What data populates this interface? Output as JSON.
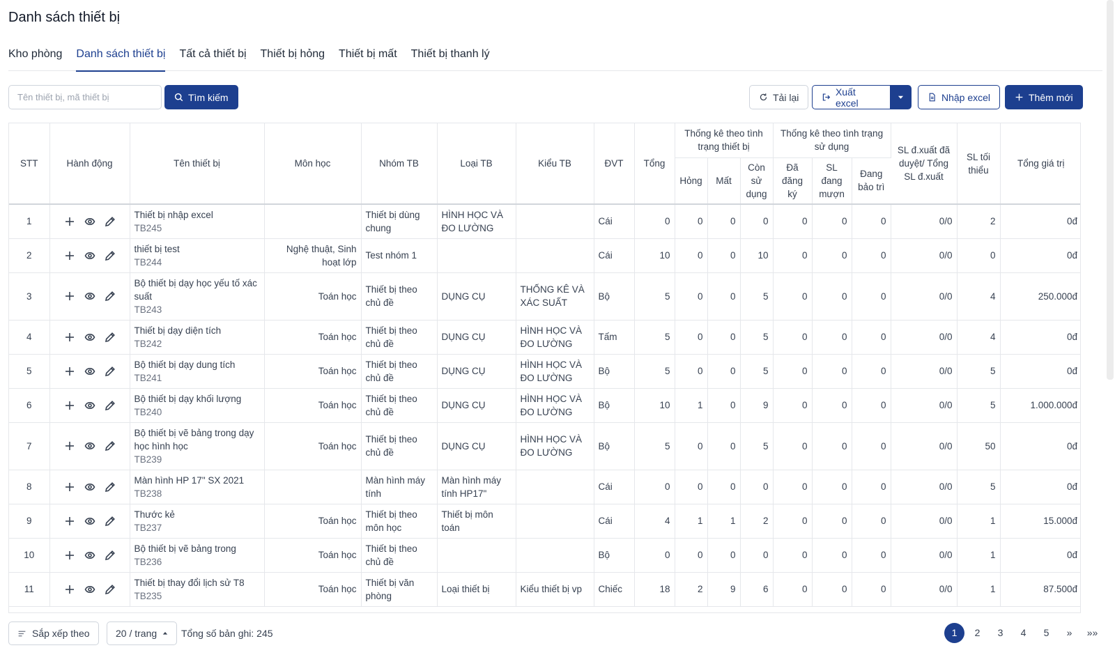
{
  "page_title": "Danh sách thiết bị",
  "tabs": [
    {
      "label": "Kho phòng",
      "active": false
    },
    {
      "label": "Danh sách thiết bị",
      "active": true
    },
    {
      "label": "Tất cả thiết bị",
      "active": false
    },
    {
      "label": "Thiết bị hỏng",
      "active": false
    },
    {
      "label": "Thiết bị mất",
      "active": false
    },
    {
      "label": "Thiết bị thanh lý",
      "active": false
    }
  ],
  "toolbar": {
    "search_placeholder": "Tên thiết bị, mã thiết bị",
    "search_label": "Tìm kiếm",
    "reload_label": "Tải lại",
    "export_label": "Xuất excel",
    "import_label": "Nhập excel",
    "add_label": "Thêm mới"
  },
  "table": {
    "headers": {
      "stt": "STT",
      "action": "Hành động",
      "name": "Tên thiết bị",
      "subject": "Môn học",
      "group": "Nhóm TB",
      "type": "Loại TB",
      "style": "Kiểu TB",
      "unit": "ĐVT",
      "total": "Tổng",
      "cond_group": "Thống kê theo tình trạng thiết bị",
      "broken": "Hỏng",
      "lost": "Mất",
      "usable": "Còn sử dụng",
      "usage_group": "Thống kê theo tình trạng sử dụng",
      "registered": "Đã đăng ký",
      "borrowed": "SL đang mượn",
      "maintenance": "Đang bảo trì",
      "export_ratio": "SL đ.xuất đã duyệt/ Tổng SL đ.xuất",
      "min_qty": "SL tối thiểu",
      "total_value": "Tổng giá trị"
    },
    "rows": [
      {
        "stt": "1",
        "name": "Thiết bị nhập excel",
        "code": "TB245",
        "subject": "",
        "group": "Thiết bị dùng chung",
        "type": "HÌNH HỌC VÀ ĐO LƯỜNG",
        "style": "",
        "unit": "Cái",
        "total": "0",
        "broken": "0",
        "lost": "0",
        "usable": "0",
        "registered": "0",
        "borrowed": "0",
        "maintenance": "0",
        "ratio": "0/0",
        "min": "2",
        "value": "0đ"
      },
      {
        "stt": "2",
        "name": "thiết bị test",
        "code": "TB244",
        "subject": "Nghệ thuật, Sinh hoạt lớp",
        "group": "Test nhóm 1",
        "type": "",
        "style": "",
        "unit": "Cái",
        "total": "10",
        "broken": "0",
        "lost": "0",
        "usable": "10",
        "registered": "0",
        "borrowed": "0",
        "maintenance": "0",
        "ratio": "0/0",
        "min": "0",
        "value": "0đ"
      },
      {
        "stt": "3",
        "name": "Bộ thiết bị dạy học yếu tố xác suất",
        "code": "TB243",
        "subject": "Toán học",
        "group": "Thiết bị theo chủ đề",
        "type": "DỤNG CỤ",
        "style": "THỐNG KÊ VÀ XÁC SUẤT",
        "unit": "Bộ",
        "total": "5",
        "broken": "0",
        "lost": "0",
        "usable": "5",
        "registered": "0",
        "borrowed": "0",
        "maintenance": "0",
        "ratio": "0/0",
        "min": "4",
        "value": "250.000đ"
      },
      {
        "stt": "4",
        "name": "Thiết bị dạy diện tích",
        "code": "TB242",
        "subject": "Toán học",
        "group": "Thiết bị theo chủ đề",
        "type": "DỤNG CỤ",
        "style": "HÌNH HỌC VÀ ĐO LƯỜNG",
        "unit": "Tấm",
        "total": "5",
        "broken": "0",
        "lost": "0",
        "usable": "5",
        "registered": "0",
        "borrowed": "0",
        "maintenance": "0",
        "ratio": "0/0",
        "min": "4",
        "value": "0đ"
      },
      {
        "stt": "5",
        "name": "Bộ thiết bị dạy dung tích",
        "code": "TB241",
        "subject": "Toán học",
        "group": "Thiết bị theo chủ đề",
        "type": "DỤNG CỤ",
        "style": "HÌNH HỌC VÀ ĐO LƯỜNG",
        "unit": "Bộ",
        "total": "5",
        "broken": "0",
        "lost": "0",
        "usable": "5",
        "registered": "0",
        "borrowed": "0",
        "maintenance": "0",
        "ratio": "0/0",
        "min": "5",
        "value": "0đ"
      },
      {
        "stt": "6",
        "name": "Bộ thiết bị dạy khối lượng",
        "code": "TB240",
        "subject": "Toán học",
        "group": "Thiết bị theo chủ đề",
        "type": "DỤNG CỤ",
        "style": "HÌNH HỌC VÀ ĐO LƯỜNG",
        "unit": "Bộ",
        "total": "10",
        "broken": "1",
        "lost": "0",
        "usable": "9",
        "registered": "0",
        "borrowed": "0",
        "maintenance": "0",
        "ratio": "0/0",
        "min": "5",
        "value": "1.000.000đ"
      },
      {
        "stt": "7",
        "name": "Bộ thiết bị vẽ bảng trong dạy học hình học",
        "code": "TB239",
        "subject": "Toán học",
        "group": "Thiết bị theo chủ đề",
        "type": "DỤNG CỤ",
        "style": "HÌNH HỌC VÀ ĐO LƯỜNG",
        "unit": "Bộ",
        "total": "5",
        "broken": "0",
        "lost": "0",
        "usable": "5",
        "registered": "0",
        "borrowed": "0",
        "maintenance": "0",
        "ratio": "0/0",
        "min": "50",
        "value": "0đ"
      },
      {
        "stt": "8",
        "name": "Màn hình HP 17\" SX 2021",
        "code": "TB238",
        "subject": "",
        "group": "Màn hình máy tính",
        "type": "Màn hình máy tính HP17\"",
        "style": "",
        "unit": "Cái",
        "total": "0",
        "broken": "0",
        "lost": "0",
        "usable": "0",
        "registered": "0",
        "borrowed": "0",
        "maintenance": "0",
        "ratio": "0/0",
        "min": "5",
        "value": "0đ"
      },
      {
        "stt": "9",
        "name": "Thước kẻ",
        "code": "TB237",
        "subject": "Toán học",
        "group": "Thiết bị theo môn học",
        "type": "Thiết bị môn toán",
        "style": "",
        "unit": "Cái",
        "total": "4",
        "broken": "1",
        "lost": "1",
        "usable": "2",
        "registered": "0",
        "borrowed": "0",
        "maintenance": "0",
        "ratio": "0/0",
        "min": "1",
        "value": "15.000đ"
      },
      {
        "stt": "10",
        "name": "Bộ thiết bị vẽ bảng trong",
        "code": "TB236",
        "subject": "Toán học",
        "group": "Thiết bị theo chủ đề",
        "type": "",
        "style": "",
        "unit": "Bộ",
        "total": "0",
        "broken": "0",
        "lost": "0",
        "usable": "0",
        "registered": "0",
        "borrowed": "0",
        "maintenance": "0",
        "ratio": "0/0",
        "min": "1",
        "value": "0đ"
      },
      {
        "stt": "11",
        "name": "Thiết bị thay đổi lịch sử T8",
        "code": "TB235",
        "subject": "Toán học",
        "group": "Thiết bị văn phòng",
        "type": "Loại thiết bị",
        "style": "Kiểu thiết bị vp",
        "unit": "Chiếc",
        "total": "18",
        "broken": "2",
        "lost": "9",
        "usable": "6",
        "registered": "0",
        "borrowed": "0",
        "maintenance": "0",
        "ratio": "0/0",
        "min": "1",
        "value": "87.500đ"
      }
    ]
  },
  "footer": {
    "sort_label": "Sắp xếp theo",
    "page_size_label": "20 / trang",
    "total_records": "Tổng số bản ghi: 245",
    "pages": [
      "1",
      "2",
      "3",
      "4",
      "5"
    ],
    "next": "»",
    "last": "»»"
  },
  "colors": {
    "primary": "#1d3f8f",
    "border": "#e5e7eb",
    "text": "#374151"
  }
}
